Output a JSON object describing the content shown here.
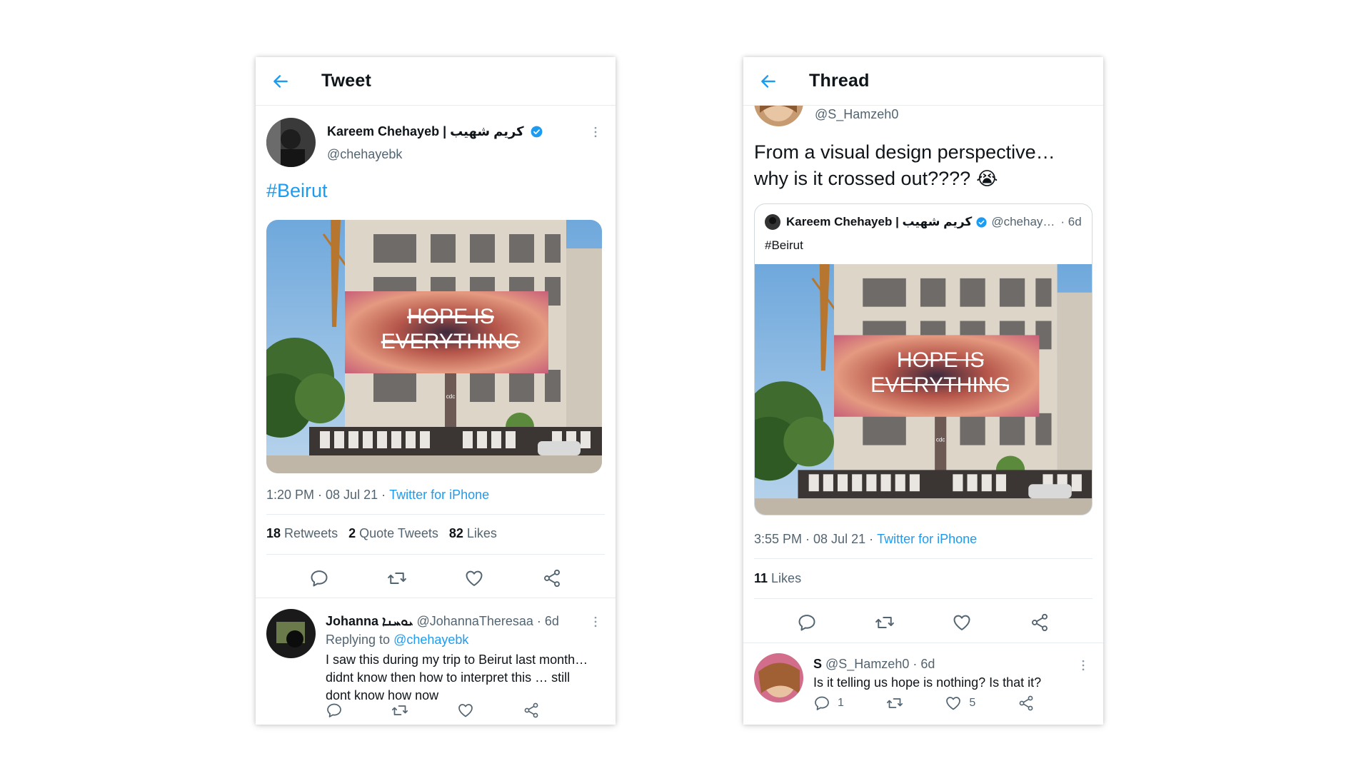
{
  "left": {
    "header_title": "Tweet",
    "tweet": {
      "author_name": "Kareem Chehayeb | كريم شهيب",
      "author_handle": "@chehayebk",
      "text": "#Beirut",
      "billboard": {
        "line1": "HOPE IS",
        "line2": "EVERYTHING",
        "brand": "cdc"
      },
      "timestamp": "1:20 PM · 08 Jul 21 · ",
      "source": "Twitter for iPhone",
      "retweets_count": "18",
      "retweets_label": "Retweets",
      "quote_count": "2",
      "quote_label": "Quote Tweets",
      "likes_count": "82",
      "likes_label": "Likes"
    },
    "reply": {
      "author_name": "Johanna ܝܘܚܢܐ",
      "author_handle": "@JohannaTheresaa · 6d",
      "replying_prefix": "Replying to ",
      "replying_handle": "@chehayebk",
      "text_line1": "I saw this during my trip to Beirut last month…",
      "text_line2": "didnt know then how to interpret this … still",
      "text_line3": "dont know how now"
    }
  },
  "right": {
    "header_title": "Thread",
    "tweet": {
      "author_handle": "@S_Hamzeh0",
      "text_line1": "From a visual design perspective…",
      "text_line2": "why is it crossed out????",
      "emoji": "😭",
      "timestamp": "3:55 PM · 08 Jul 21 · ",
      "source": "Twitter for iPhone",
      "likes_count": "11",
      "likes_label": "Likes"
    },
    "quote": {
      "author_name": "Kareem Chehayeb | كريم شهيب",
      "author_handle": "@chehay…",
      "time": "· 6d",
      "text": "#Beirut",
      "billboard": {
        "line1": "HOPE IS",
        "line2": "EVERYTHING",
        "brand": "cdc"
      }
    },
    "reply": {
      "author_name": "S",
      "author_handle": "@S_Hamzeh0 · 6d",
      "text": "Is it telling us hope is nothing? Is that it?",
      "reply_count": "1",
      "like_count": "5"
    }
  },
  "colors": {
    "accent": "#1d9bf0",
    "text": "#0f1419",
    "secondary": "#536471",
    "divider": "#e6ecf0"
  },
  "icons": [
    "back-arrow-icon",
    "verified-badge-icon",
    "more-icon",
    "reply-icon",
    "retweet-icon",
    "like-icon",
    "share-icon"
  ]
}
